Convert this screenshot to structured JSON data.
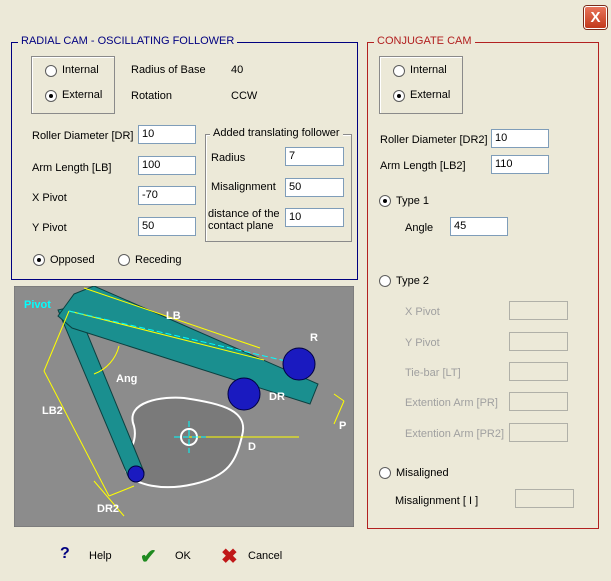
{
  "window": {
    "close_label": "X"
  },
  "radial": {
    "title": "RADIAL CAM - OSCILLATING FOLLOWER",
    "internal": "Internal",
    "external": "External",
    "radius_of_base_label": "Radius of Base",
    "radius_of_base_value": "40",
    "rotation_label": "Rotation",
    "rotation_value": "CCW",
    "roller_diameter_label": "Roller Diameter [DR]",
    "roller_diameter_value": "10",
    "arm_length_label": "Arm Length [LB]",
    "arm_length_value": "100",
    "x_pivot_label": "X Pivot",
    "x_pivot_value": "-70",
    "y_pivot_label": "Y Pivot",
    "y_pivot_value": "50",
    "opposed": "Opposed",
    "receding": "Receding",
    "translating": {
      "title": "Added translating follower",
      "radius_label": "Radius",
      "radius_value": "7",
      "misalignment_label": "Misalignment",
      "misalignment_value": "50",
      "distance_label_1": "distance of the",
      "distance_label_2": "contact plane",
      "distance_value": "10"
    }
  },
  "diagram": {
    "pivot": "Pivot",
    "lb": "LB",
    "r": "R",
    "ang": "Ang",
    "dr": "DR",
    "lb2": "LB2",
    "p": "P",
    "d": "D",
    "dr2": "DR2"
  },
  "conjugate": {
    "title": "CONJUGATE CAM",
    "internal": "Internal",
    "external": "External",
    "roller_diameter_label": "Roller Diameter [DR2]",
    "roller_diameter_value": "10",
    "arm_length_label": "Arm Length [LB2]",
    "arm_length_value": "110",
    "type1": "Type 1",
    "angle_label": "Angle",
    "angle_value": "45",
    "type2": "Type 2",
    "x_pivot_label": "X Pivot",
    "y_pivot_label": "Y Pivot",
    "tie_bar_label": "Tie-bar [LT]",
    "ext_arm_pr_label": "Extention Arm [PR]",
    "ext_arm_pr2_label": "Extention Arm [PR2]",
    "misaligned": "Misaligned",
    "misalignment_label": "Misalignment [ I ]"
  },
  "buttons": {
    "help": "Help",
    "ok": "OK",
    "cancel": "Cancel"
  },
  "colors": {
    "arm": "#1a8f8f",
    "roller": "#1a1ac0",
    "diagram_bg": "#8c8c8c",
    "dimension": "#ffff00",
    "pivot_text": "#00ffff"
  }
}
